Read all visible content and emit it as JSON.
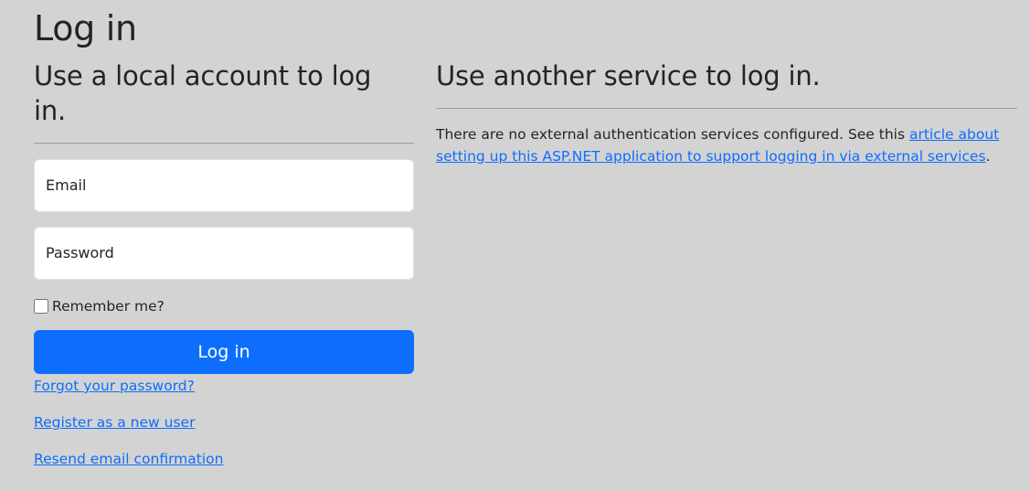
{
  "page": {
    "title": "Log in"
  },
  "local_account": {
    "heading": "Use a local account to log in.",
    "email_label": "Email",
    "password_label": "Password",
    "remember_label": "Remember me?",
    "remember_checked": false,
    "login_button_label": "Log in",
    "links": {
      "forgot_password": "Forgot your password?",
      "register": "Register as a new user",
      "resend_confirmation": "Resend email confirmation"
    }
  },
  "external_service": {
    "heading": "Use another service to log in.",
    "text_before_link": "There are no external authentication services configured. See this ",
    "link_text": "article about setting up this ASP.NET application to support logging in via external services",
    "text_after_link": "."
  },
  "colors": {
    "background": "#d3d3d3",
    "primary": "#0d6efd",
    "text": "#212529"
  }
}
